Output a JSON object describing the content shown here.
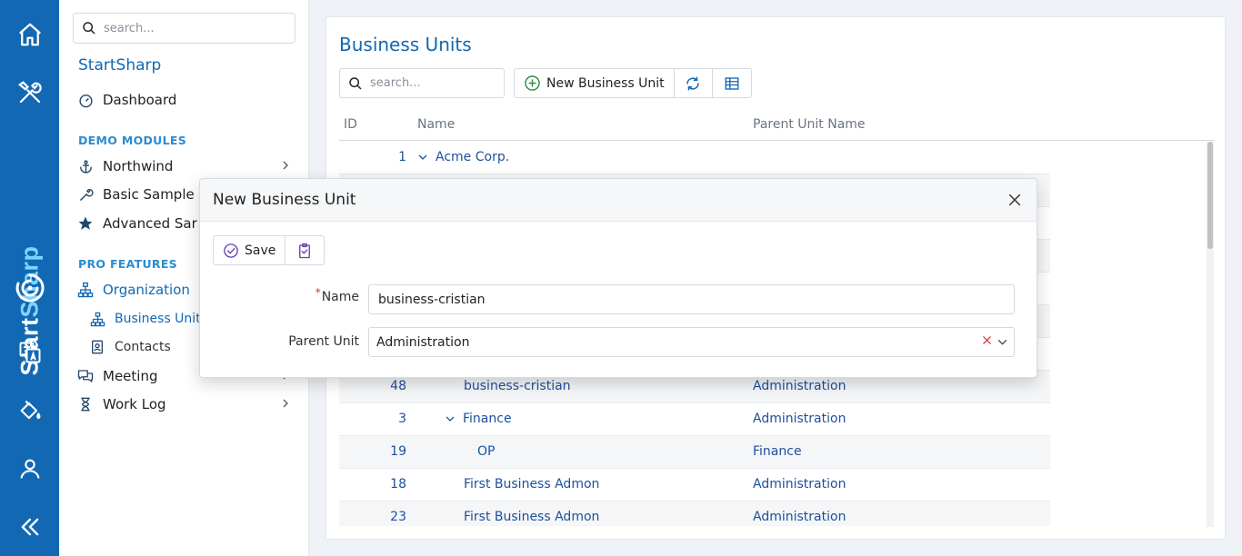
{
  "rail": {
    "brand": {
      "part1": "Start",
      "part2": "Sharp"
    }
  },
  "sidebar": {
    "search_placeholder": "search...",
    "title": "StartSharp",
    "dashboard": "Dashboard",
    "demo_section": "DEMO MODULES",
    "northwind": "Northwind",
    "basic_samples": "Basic Sample",
    "advanced_samples": "Advanced Sar",
    "pro_section": "PRO FEATURES",
    "organization": "Organization",
    "business_units": "Business Unit",
    "contacts": "Contacts",
    "meeting": "Meeting",
    "work_log": "Work Log"
  },
  "main": {
    "title": "Business Units",
    "search_placeholder": "search...",
    "new_button": "New Business Unit",
    "columns": {
      "id": "ID",
      "name": "Name",
      "parent": "Parent Unit Name"
    },
    "rows": [
      {
        "id": "1",
        "name": "Acme Corp.",
        "parent": ""
      },
      {
        "id": "48",
        "name": "business-cristian",
        "parent": "Administration"
      },
      {
        "id": "3",
        "name": "Finance",
        "parent": "Administration"
      },
      {
        "id": "19",
        "name": "OP",
        "parent": "Finance"
      },
      {
        "id": "18",
        "name": "First Business Admon",
        "parent": "Administration"
      },
      {
        "id": "23",
        "name": "First Business Admon",
        "parent": "Administration"
      }
    ]
  },
  "dialog": {
    "title": "New Business Unit",
    "save_label": "Save",
    "name_label": "Name",
    "name_value": "business-cristian",
    "parent_label": "Parent Unit",
    "parent_value": "Administration"
  },
  "colors": {
    "brand_blue": "#1268b3",
    "link_blue": "#1e4f9e",
    "section_blue": "#2b8bd1",
    "required_red": "#d9342b"
  }
}
